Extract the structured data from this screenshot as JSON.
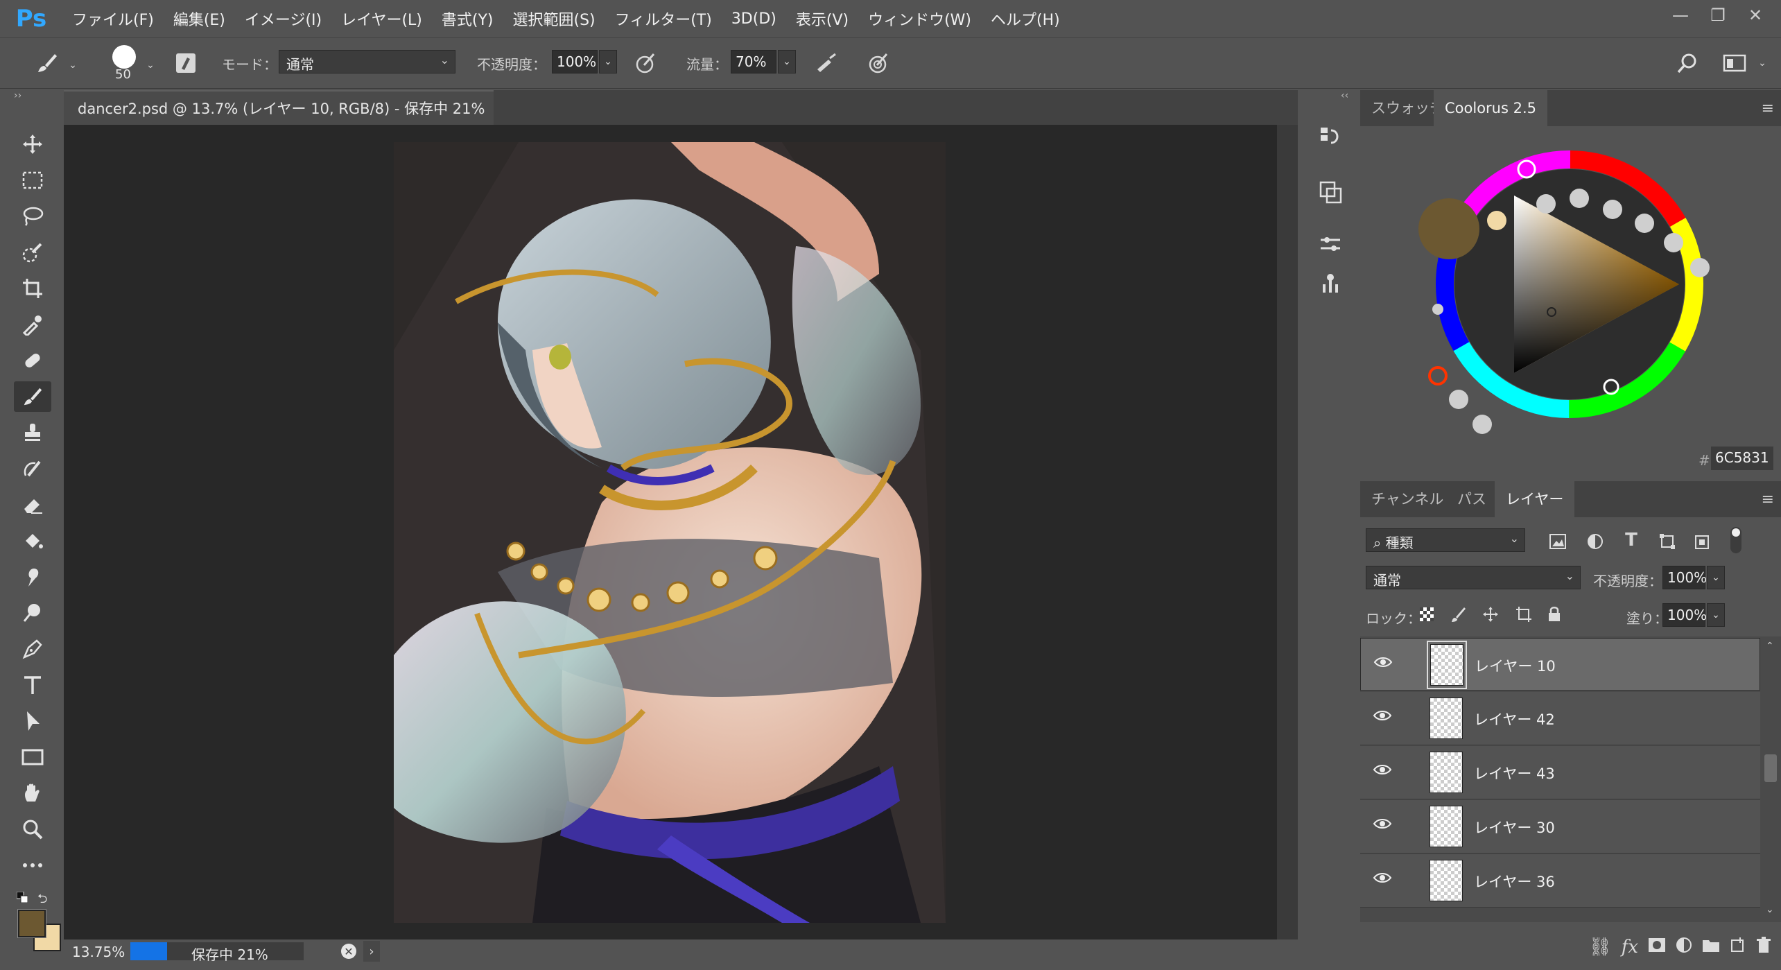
{
  "app": {
    "logo": "Ps"
  },
  "menu": [
    "ファイル(F)",
    "編集(E)",
    "イメージ(I)",
    "レイヤー(L)",
    "書式(Y)",
    "選択範囲(S)",
    "フィルター(T)",
    "3D(D)",
    "表示(V)",
    "ウィンドウ(W)",
    "ヘルプ(H)"
  ],
  "window_controls": {
    "minimize": "—",
    "restore": "❐",
    "close": "✕"
  },
  "options": {
    "brush_size": "50",
    "mode_label": "モード：",
    "mode_value": "通常",
    "opacity_label": "不透明度：",
    "opacity_value": "100%",
    "flow_label": "流量：",
    "flow_value": "70%"
  },
  "document": {
    "tab_title": "dancer2.psd @ 13.7% (レイヤー 10, RGB/8) - 保存中 21%",
    "tab_close": "×"
  },
  "status": {
    "zoom": "13.75%",
    "saving_text": "保存中 21%",
    "progress": 0.21
  },
  "color_panel": {
    "tabs": [
      "スウォッチ",
      "Coolorus 2.5"
    ],
    "active_tab": 1,
    "hex_label": "#",
    "hex_value": "6C5831",
    "foreground": "#6c5831",
    "background": "#f1d9a6"
  },
  "layers_panel": {
    "tabs": [
      "チャンネル",
      "パス",
      "レイヤー"
    ],
    "active_tab": 2,
    "filter_value": "種類",
    "blend_mode": "通常",
    "opacity_label": "不透明度：",
    "opacity_value": "100%",
    "lock_label": "ロック：",
    "fill_label": "塗り：",
    "fill_value": "100%",
    "layers": [
      {
        "name": "レイヤー 10",
        "visible": true,
        "selected": true
      },
      {
        "name": "レイヤー 42",
        "visible": true,
        "selected": false
      },
      {
        "name": "レイヤー 43",
        "visible": true,
        "selected": false
      },
      {
        "name": "レイヤー 30",
        "visible": true,
        "selected": false
      },
      {
        "name": "レイヤー 36",
        "visible": true,
        "selected": false
      }
    ]
  },
  "tools": [
    "move-tool",
    "marquee-tool",
    "lasso-tool",
    "quick-select-tool",
    "crop-tool",
    "eyedropper-tool",
    "healing-brush-tool",
    "brush-tool",
    "stamp-tool",
    "history-brush-tool",
    "eraser-tool",
    "paint-bucket-tool",
    "smudge-tool",
    "dodge-tool",
    "pen-tool",
    "type-tool",
    "path-select-tool",
    "rectangle-tool",
    "hand-tool",
    "zoom-tool",
    "more-tools"
  ],
  "active_tool": "brush-tool"
}
